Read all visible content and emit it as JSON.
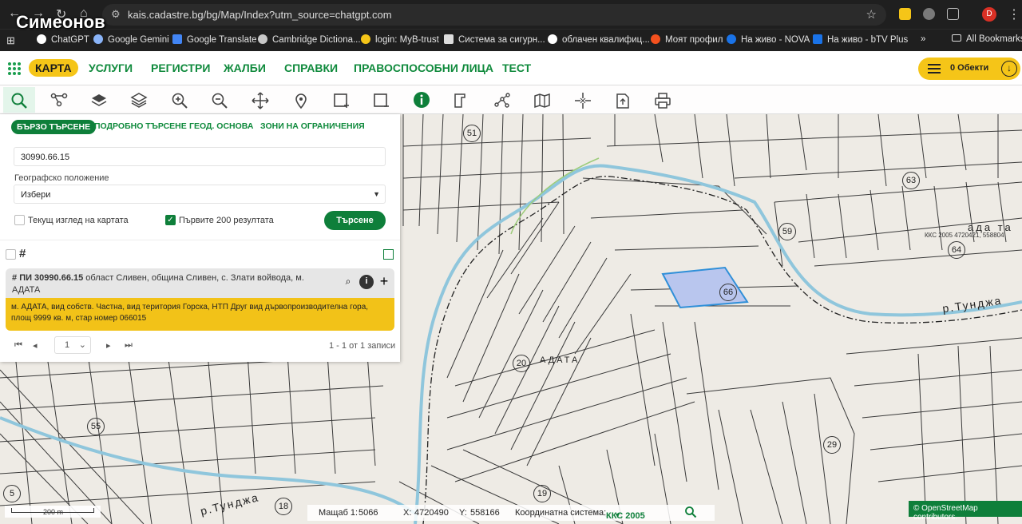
{
  "browser": {
    "url": "kais.cadastre.bg/bg/Map/Index?utm_source=chatgpt.com",
    "profile_initial": "D",
    "watermark": "Симеонов",
    "bookmarks": [
      {
        "label": "ChatGPT",
        "color": "#ffffff"
      },
      {
        "label": "Google Gemini",
        "color": "#8ab4f8"
      },
      {
        "label": "Google Translate",
        "color": "#4285f4"
      },
      {
        "label": "Cambridge Dictiona...",
        "color": "#c8c8c8"
      },
      {
        "label": "login: MyB-trust",
        "color": "#f5c518"
      },
      {
        "label": "Система за сигурн...",
        "color": "#dddddd"
      },
      {
        "label": "облачен квалифиц...",
        "color": "#ffffff"
      },
      {
        "label": "Моят профил",
        "color": "#f4511e"
      },
      {
        "label": "На живо - NOVA",
        "color": "#1a73e8"
      },
      {
        "label": "На живо - bTV Plus",
        "color": "#1a73e8"
      }
    ],
    "more_label": "»",
    "all_bookmarks": "All Bookmarks"
  },
  "app": {
    "menu": [
      "КАРТА",
      "УСЛУГИ",
      "РЕГИСТРИ",
      "ЖАЛБИ",
      "СПРАВКИ",
      "ПРАВОСПОСОБНИ ЛИЦА",
      "ТЕСТ"
    ],
    "objects_label": "0 Обекти"
  },
  "search": {
    "tabs": [
      "БЪРЗО ТЪРСЕНЕ",
      "ПОДРОБНО ТЪРСЕНЕ",
      "ГЕОД. ОСНОВА",
      "ЗОНИ НА ОГРАНИЧЕНИЯ"
    ],
    "query": "30990.66.15",
    "geo_label": "Географско положение",
    "geo_value": "Избери",
    "chk_current_view": "Текущ изглед на картата",
    "chk_first_200": "Първите 200 резултата",
    "button": "Търсене"
  },
  "result": {
    "id": "ПИ 30990.66.15",
    "location": " област Сливен, община Сливен, с. Злати войвода, м. АДАТА",
    "details": "м. АДАТА, вид собств. Частна, вид територия Горска, НТП Друг вид дървопроизводителна гора, площ 9999 кв. м, стар номер 066015"
  },
  "pager": {
    "page": "1",
    "summary": "1 - 1 от 1 записи"
  },
  "map": {
    "crs_text": "ККС 2005 4720421, 558804",
    "parcel_numbers": [
      "51",
      "63",
      "59",
      "64",
      "66",
      "20",
      "55",
      "29",
      "19",
      "18",
      "5"
    ],
    "locality": "АДАТА",
    "river_label_1": "р.Тунджа",
    "river_label_2": "р.Тунджа",
    "top_river_fragment": "ада та",
    "scale_label": "200 m",
    "osm": "© OpenStreetMap contributors."
  },
  "status": {
    "scale_label": "Мащаб 1:",
    "scale_value": "5066",
    "x_label": "X:",
    "x_value": "4720490",
    "y_label": "Y:",
    "y_value": "558166",
    "crs_label": "Координатна система:",
    "crs_value": "ККС 2005"
  },
  "colors": {
    "accent_green": "#0e7f3a",
    "accent_yellow": "#f5c518",
    "river_blue": "#8fc6dc",
    "parcel_highlight": "#b9c6ee"
  }
}
